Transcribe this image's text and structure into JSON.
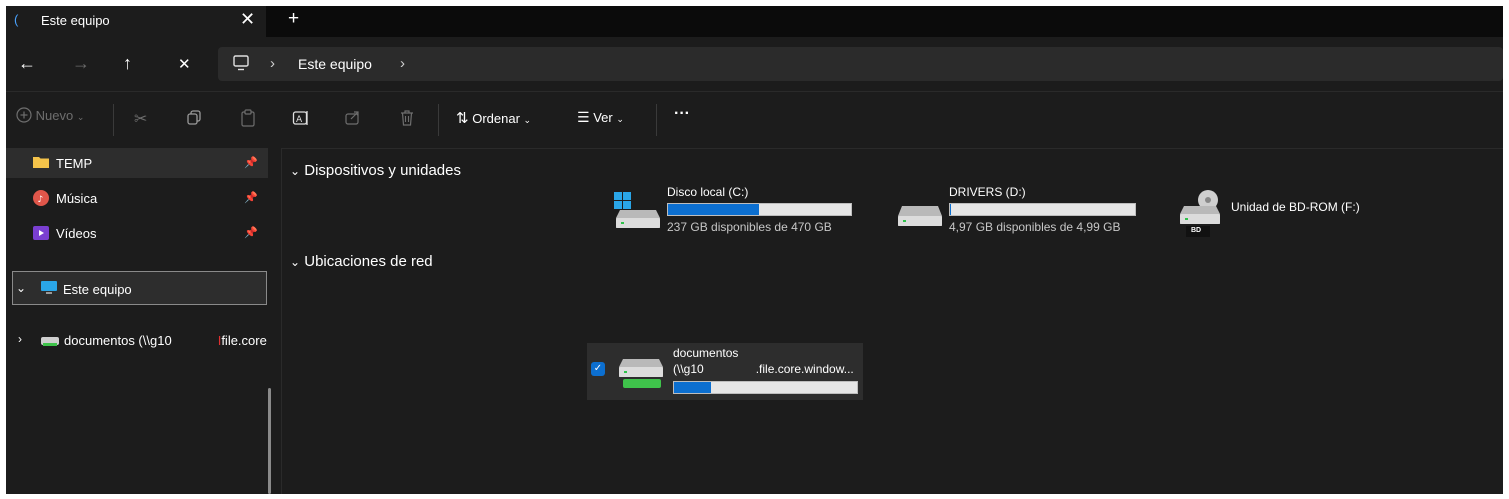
{
  "tabs": [
    {
      "title": "Este equipo",
      "close_icon": "close-icon"
    }
  ],
  "new_tab_glyph": "+",
  "nav": {
    "back": "←",
    "forward": "→",
    "up": "↑",
    "close": "✕"
  },
  "address": {
    "separator": "›",
    "crumbs": [
      "Este equipo"
    ]
  },
  "toolbar": {
    "new_label": "Nuevo",
    "sort_label": "Ordenar",
    "view_label": "Ver",
    "more_label": "···"
  },
  "sidebar": {
    "items": [
      {
        "label": "TEMP",
        "icon": "folder-icon",
        "pinned": true
      },
      {
        "label": "Música",
        "icon": "music-icon",
        "pinned": true
      },
      {
        "label": "Vídeos",
        "icon": "video-icon",
        "pinned": true
      },
      {
        "label": "Este equipo",
        "icon": "pc-icon"
      },
      {
        "label": "documentos (\\\\g10",
        "label_suffix": "file.core",
        "icon": "network-drive-icon"
      }
    ]
  },
  "sections": {
    "devices_title": "Dispositivos y unidades",
    "network_title": "Ubicaciones de red"
  },
  "drives": [
    {
      "name": "Disco local (C:)",
      "free": "237 GB disponibles de 470 GB",
      "used_fraction": 0.496,
      "icon": "windows-drive-icon"
    },
    {
      "name": "DRIVERS (D:)",
      "free": "4,97 GB disponibles de 4,99 GB",
      "used_fraction": 0.004,
      "icon": "drive-icon"
    },
    {
      "name": "Unidad de BD-ROM (F:)",
      "icon": "bd-rom-icon",
      "badge": "BD"
    }
  ],
  "network_locations": [
    {
      "name": "documentos",
      "path_prefix": "(\\\\g10",
      "path_suffix": ".file.core.window...",
      "used_fraction": 0.2,
      "selected": true,
      "icon": "network-drive-icon"
    }
  ],
  "colors": {
    "accent": "#0c6fd0",
    "background": "#1c1c1c"
  }
}
